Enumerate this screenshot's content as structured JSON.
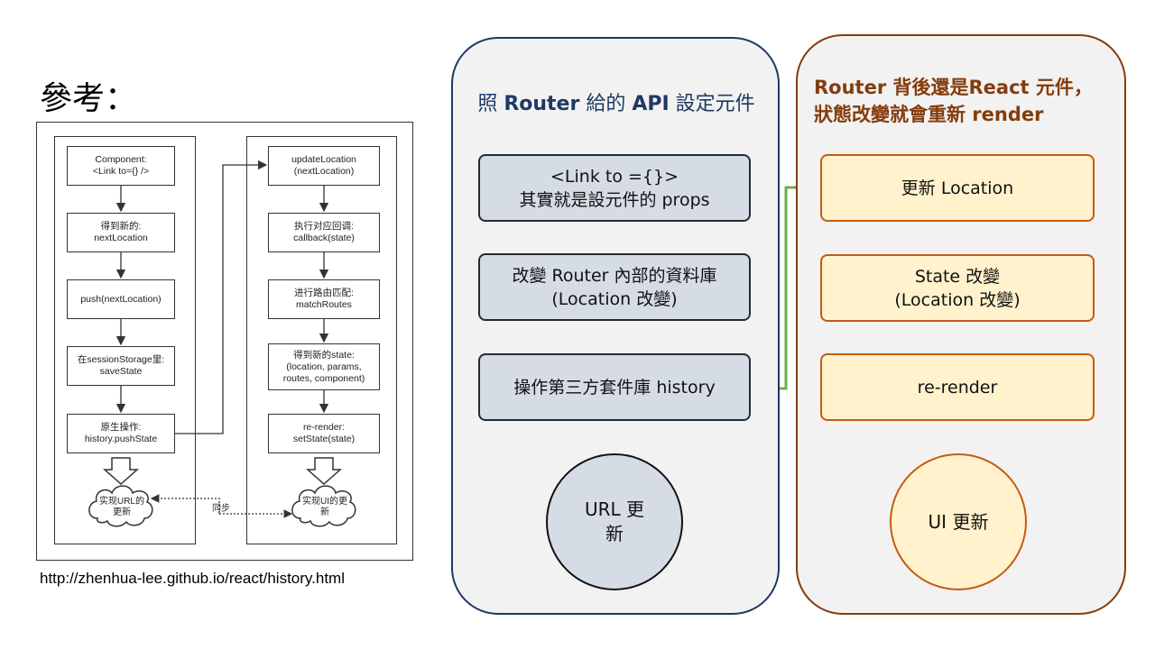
{
  "reference": {
    "title": "參考：",
    "url": "http://zhenhua-lee.github.io/react/history.html",
    "left_column": [
      "Component:\n<Link to={} />",
      "得到新的:\nnextLocation",
      "push(nextLocation)",
      "在sessionStorage里:\nsaveState",
      "原生操作:\nhistory.pushState"
    ],
    "right_column": [
      "updateLocation\n(nextLocation)",
      "执行对应回调:\ncallback(state)",
      "进行路由匹配:\nmatchRoutes",
      "得到新的state:\n(location, params,\nroutes, component)",
      "re-render:\nsetState(state)"
    ],
    "left_cloud": "实现URL的\n更新",
    "right_cloud": "实现UI的更\n新",
    "sync_label": "同步"
  },
  "left_panel": {
    "title_parts": [
      "照 ",
      "Router",
      " 給的 ",
      "API",
      " 設定元件"
    ],
    "boxes": [
      "<Link to ={}>\n其實就是設元件的 props",
      "改變 Router 內部的資料庫\n(Location 改變)",
      "操作第三方套件庫 history"
    ],
    "circle": "URL 更\n新"
  },
  "right_panel": {
    "title_line1": "Router 背後還是React 元件，",
    "title_line2": "狀態改變就會重新 render",
    "boxes": [
      "更新 Location",
      "State 改變\n(Location 改變)",
      "re-render"
    ],
    "circle": "UI 更新"
  },
  "colors": {
    "left_border": "#1f3864",
    "left_box_fill": "#d6dce5",
    "left_arrow": "#44546a",
    "right_border": "#843c0c",
    "right_box_fill": "#fff2cc",
    "right_box_border": "#c55a11",
    "connector_green": "#70ad47",
    "panel_fill": "#f2f2f2"
  }
}
